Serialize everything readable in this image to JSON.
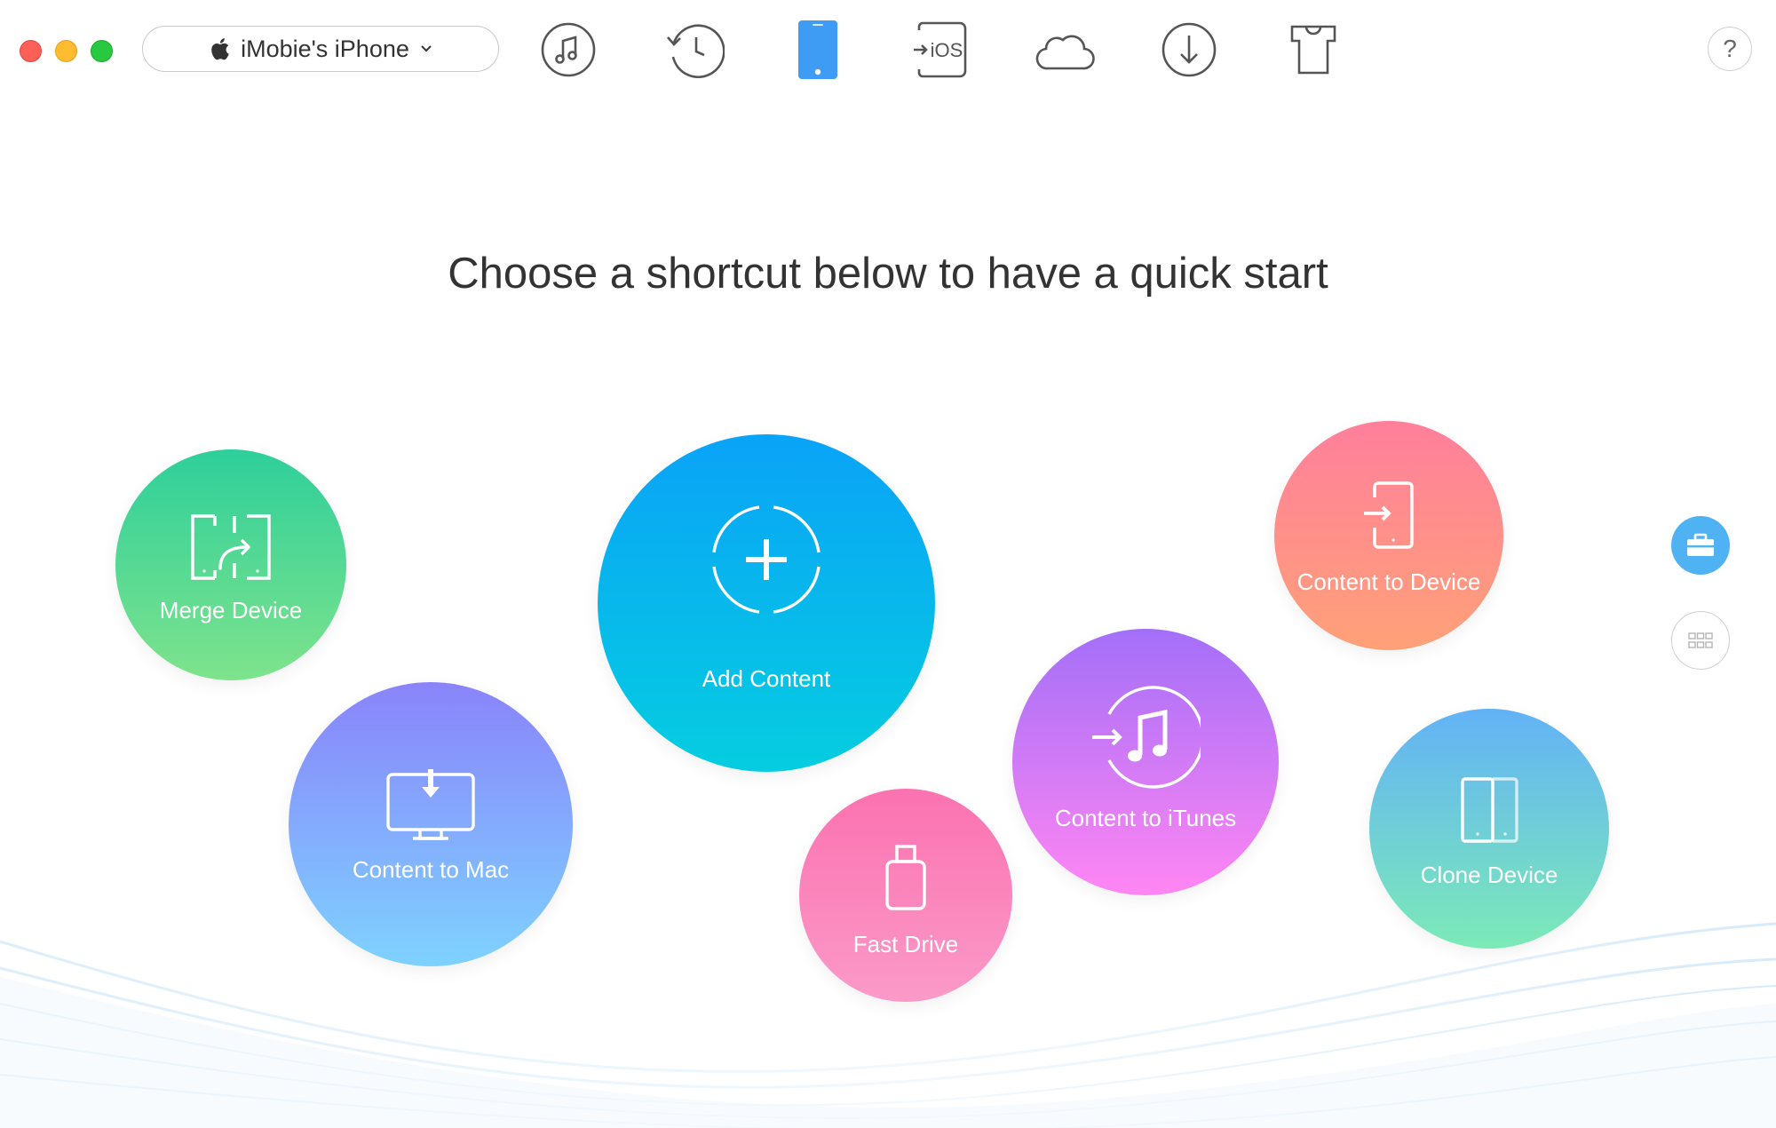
{
  "window": {
    "device_name": "iMobie's iPhone",
    "help_label": "?"
  },
  "toolbar": {
    "icons": [
      "music-icon",
      "history-icon",
      "phone-icon",
      "to-ios-icon",
      "cloud-icon",
      "download-icon",
      "shirt-icon"
    ],
    "active": "phone-icon",
    "to_ios_text": "iOS"
  },
  "main": {
    "headline": "Choose a shortcut below to have a quick start"
  },
  "shortcuts": [
    {
      "label": "Merge Device",
      "colors": [
        "#2ecf9b",
        "#7ee38c"
      ]
    },
    {
      "label": "Content to Mac",
      "colors": [
        "#8a83fb",
        "#7ed2ff"
      ]
    },
    {
      "label": "Add Content",
      "colors": [
        "#0aa3f7",
        "#05cde0"
      ]
    },
    {
      "label": "Fast Drive",
      "colors": [
        "#fb72b0",
        "#fb9ac8"
      ]
    },
    {
      "label": "Content to iTunes",
      "colors": [
        "#a36ff8",
        "#ff86f3"
      ]
    },
    {
      "label": "Content to Device",
      "colors": [
        "#ff7f9b",
        "#ffa178"
      ]
    },
    {
      "label": "Clone Device",
      "colors": [
        "#62b2f6",
        "#7ceab7"
      ]
    }
  ],
  "side_panel": {
    "toolbox_color": "#4fb3f3",
    "grid_border_color": "#cfcfcf"
  },
  "accent_color": "#3e9cf4"
}
